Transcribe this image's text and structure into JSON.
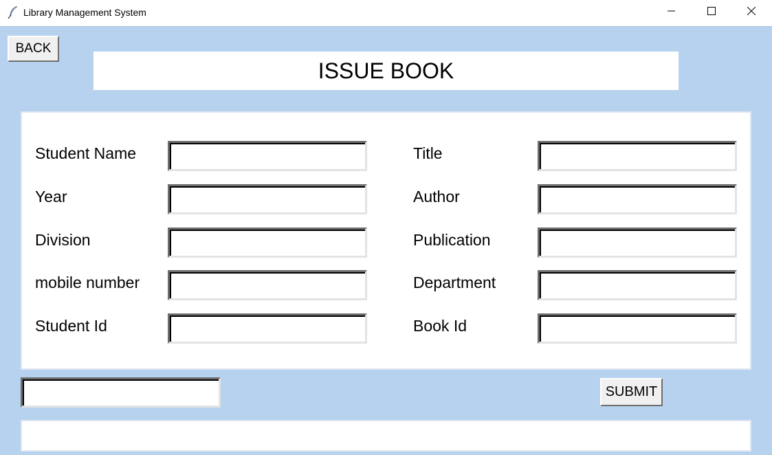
{
  "window": {
    "title": "Library Management System",
    "icon": "feather-icon",
    "controls": [
      "minimize-icon",
      "maximize-icon",
      "close-icon"
    ]
  },
  "toolbar": {
    "back_label": "BACK"
  },
  "heading": "ISSUE BOOK",
  "form": {
    "left_fields": [
      {
        "label": "Student Name",
        "value": ""
      },
      {
        "label": "Year",
        "value": ""
      },
      {
        "label": "Division",
        "value": ""
      },
      {
        "label": "mobile number",
        "value": ""
      },
      {
        "label": "Student Id",
        "value": ""
      }
    ],
    "right_fields": [
      {
        "label": "Title",
        "value": ""
      },
      {
        "label": "Author",
        "value": ""
      },
      {
        "label": "Publication",
        "value": ""
      },
      {
        "label": "Department",
        "value": ""
      },
      {
        "label": "Book Id",
        "value": ""
      }
    ]
  },
  "bottom": {
    "entry_value": "",
    "submit_label": "SUBMIT",
    "status_text": ""
  },
  "colors": {
    "background": "#b7d2ee",
    "panel": "#ffffff",
    "button_face": "#f0f0f0"
  }
}
